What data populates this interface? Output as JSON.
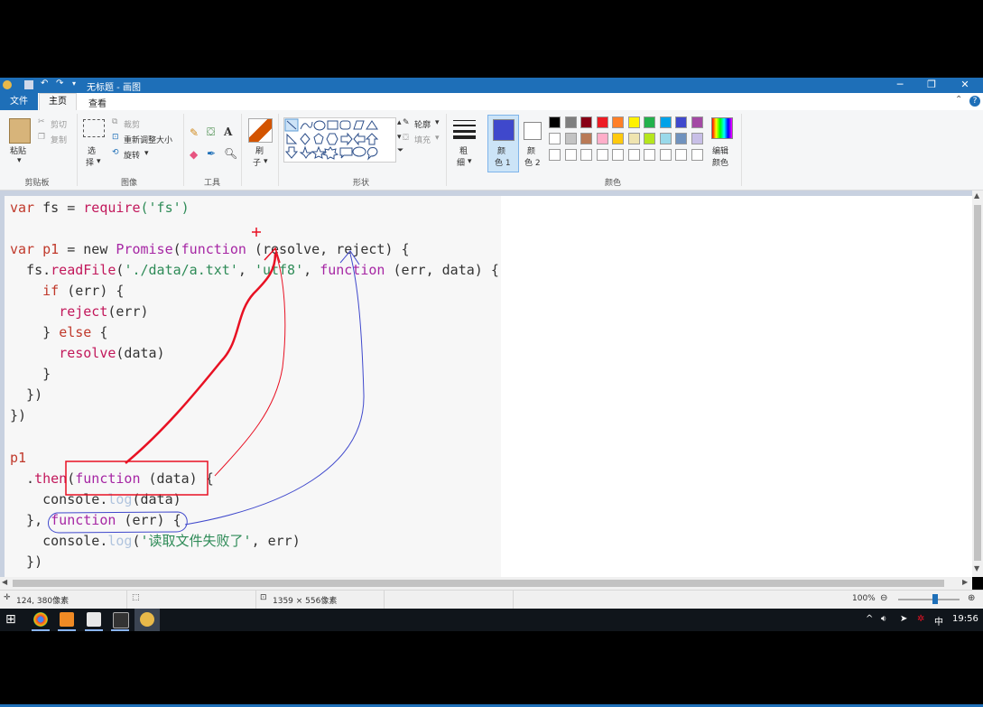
{
  "window": {
    "title": "无标题 - 画图",
    "controls": {
      "minimize": "─",
      "restore": "❐",
      "close": "✕"
    }
  },
  "tabs": {
    "file": "文件",
    "home": "主页",
    "view": "查看"
  },
  "ribbon": {
    "clipboard": {
      "paste": "粘贴",
      "cut": "剪切",
      "copy": "复制",
      "label": "剪贴板"
    },
    "image": {
      "select": "选",
      "select2": "择",
      "crop": "裁剪",
      "resize": "重新调整大小",
      "rotate": "旋转",
      "label": "图像"
    },
    "tools": {
      "label": "工具"
    },
    "brushes": {
      "label1": "刷",
      "label2": "子"
    },
    "shapes": {
      "outline": "轮廓",
      "fill": "填充",
      "label": "形状"
    },
    "size": {
      "label1": "粗",
      "label2": "细"
    },
    "color1": {
      "label1": "颜",
      "label2": "色 1",
      "color": "#3f48cc"
    },
    "color2": {
      "label1": "颜",
      "label2": "色 2",
      "color": "#ffffff"
    },
    "edit_colors": {
      "label1": "编辑",
      "label2": "颜色"
    },
    "colors_label": "颜色",
    "palette_row1": [
      "#000000",
      "#7f7f7f",
      "#880015",
      "#ed1c24",
      "#ff7f27",
      "#fff200",
      "#22b14c",
      "#00a2e8",
      "#3f48cc",
      "#a349a4"
    ],
    "palette_row2": [
      "#ffffff",
      "#c3c3c3",
      "#b97a57",
      "#ffaec9",
      "#ffc90e",
      "#efe4b0",
      "#b5e61d",
      "#99d9ea",
      "#7092be",
      "#c8bfe7"
    ],
    "palette_row3": [
      "#ffffff",
      "#ffffff",
      "#ffffff",
      "#ffffff",
      "#ffffff",
      "#ffffff",
      "#ffffff",
      "#ffffff",
      "#ffffff",
      "#ffffff"
    ]
  },
  "code": {
    "l1": [
      "var",
      " fs = ",
      "require",
      "('fs')"
    ],
    "l3": [
      "var",
      " ",
      "p1",
      " = ",
      "new",
      " ",
      "Promise",
      "(",
      "function",
      " (resolve, reject) {"
    ],
    "l4": [
      "  fs.",
      "readFile",
      "(",
      "'./data/a.txt'",
      ", ",
      "'utf8'",
      ", ",
      "function",
      " (err, data) {"
    ],
    "l5": [
      "    ",
      "if",
      " (err) {"
    ],
    "l6": [
      "      ",
      "reject",
      "(err)"
    ],
    "l7": [
      "    } ",
      "else",
      " {"
    ],
    "l8": [
      "      ",
      "resolve",
      "(data)"
    ],
    "l9": "    }",
    "l10": "  })",
    "l11": "})",
    "l13": "p1",
    "l14": [
      "  .",
      "then",
      "(",
      "function",
      " (data) {"
    ],
    "l15": [
      "    console.",
      "log",
      "(data)"
    ],
    "l16": [
      "  }, ",
      "function",
      " (err) {"
    ],
    "l17": [
      "    console.",
      "log",
      "(",
      "'读取文件失败了'",
      ", err)"
    ],
    "l18": "  })"
  },
  "status": {
    "cursor": "124, 380像素",
    "canvas_size": "1359 × 556像素",
    "zoom": "100%",
    "zoom_level": 0.6
  },
  "taskbar": {
    "ime": "中",
    "time": "19:56"
  }
}
